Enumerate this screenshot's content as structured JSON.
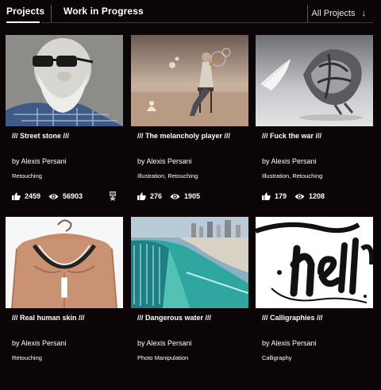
{
  "header": {
    "tabs": [
      {
        "label": "Projects",
        "active": true
      },
      {
        "label": "Work in Progress",
        "active": false
      }
    ],
    "filter": {
      "label": "All Projects",
      "icon": "arrow-down-icon"
    }
  },
  "projects": [
    {
      "title": "/// Street stone ///",
      "author": "by Alexis Persani",
      "fields": "Retouching",
      "likes": "2459",
      "views": "56903",
      "badge": "ribbon-badge-icon"
    },
    {
      "title": "/// The melancholy player ///",
      "author": "by Alexis Persani",
      "fields": "Illustration, Retouching",
      "likes": "276",
      "views": "1905"
    },
    {
      "title": "/// Fuck the war ///",
      "author": "by Alexis Persani",
      "fields": "Illustration, Retouching",
      "likes": "179",
      "views": "1208"
    },
    {
      "title": "/// Real human skin ///",
      "author": "by Alexis Persani",
      "fields": "Retouching"
    },
    {
      "title": "/// Dangerous water ///",
      "author": "by Alexis Persani",
      "fields": "Photo Manipulation"
    },
    {
      "title": "/// Calligraphies ///",
      "author": "by Alexis Persani",
      "fields": "Calligraphy"
    }
  ],
  "icons": {
    "likes": "thumbs-up-icon",
    "views": "eye-icon"
  },
  "colors": {
    "background": "#0b0507",
    "text": "#ffffff"
  }
}
